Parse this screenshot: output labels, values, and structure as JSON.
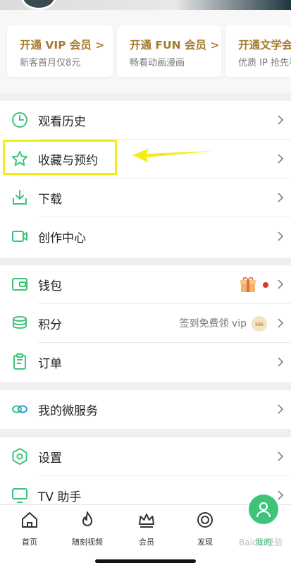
{
  "promos": [
    {
      "title": "开通 VIP 会员 >",
      "subtitle": "新客首月仅8元"
    },
    {
      "title": "开通 FUN 会员 >",
      "subtitle": "畅看动画漫画"
    },
    {
      "title": "开通文学会",
      "subtitle": "优质 IP 抢先看"
    }
  ],
  "group1": [
    {
      "label": "观看历史",
      "icon": "clock-icon"
    },
    {
      "label": "收藏与预约",
      "icon": "star-icon"
    },
    {
      "label": "下载",
      "icon": "download-icon"
    },
    {
      "label": "创作中心",
      "icon": "video-camera-icon"
    }
  ],
  "group2": [
    {
      "label": "钱包",
      "icon": "wallet-icon"
    },
    {
      "label": "积分",
      "icon": "coins-icon",
      "extra": "签到免费领 vip"
    },
    {
      "label": "订单",
      "icon": "clipboard-icon"
    }
  ],
  "group3": [
    {
      "label": "我的微服务",
      "icon": "link-icon"
    }
  ],
  "group4": [
    {
      "label": "设置",
      "icon": "hexagon-settings-icon"
    },
    {
      "label": "TV 助手",
      "icon": "tv-icon"
    }
  ],
  "tabs": [
    {
      "label": "首页",
      "icon": "home-icon"
    },
    {
      "label": "随刻视频",
      "icon": "flame-icon"
    },
    {
      "label": "会员",
      "icon": "crown-icon"
    },
    {
      "label": "发现",
      "icon": "discover-icon"
    },
    {
      "label": "我的",
      "icon": "user-icon",
      "active": true
    }
  ],
  "colors": {
    "accent": "#3cc47a",
    "gold": "#a67a2e",
    "highlight": "#f4ec13",
    "badge_dot": "#e0352b"
  },
  "watermark": "Baidu 经验"
}
